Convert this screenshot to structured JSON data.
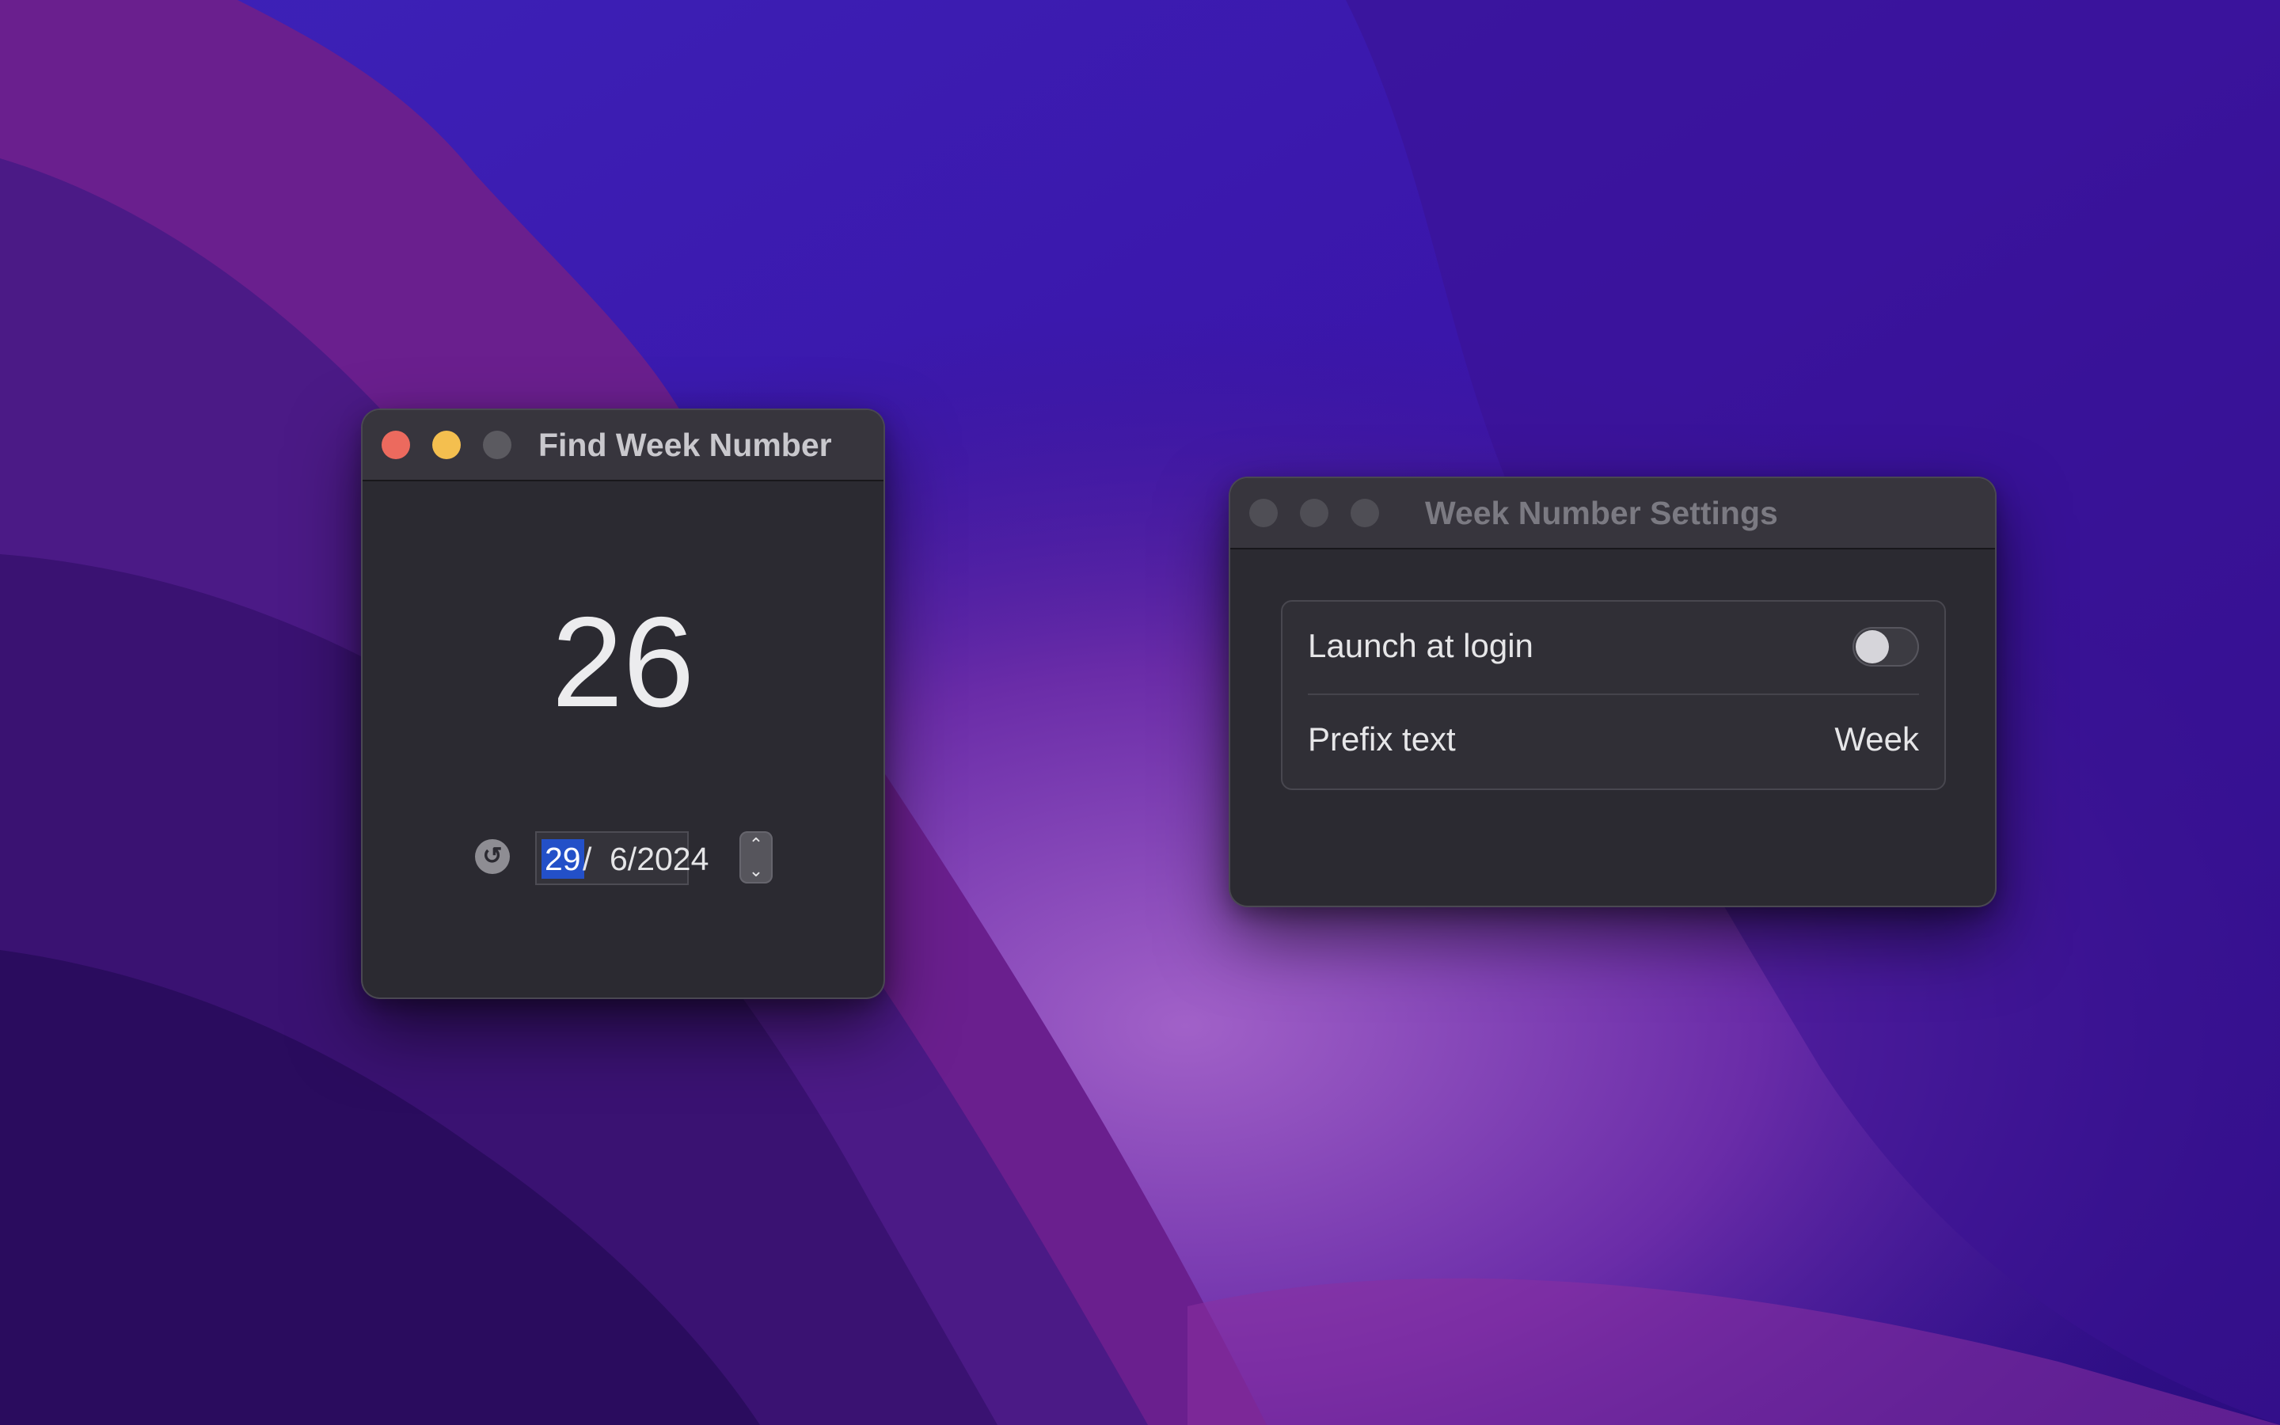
{
  "find_window": {
    "title": "Find Week Number",
    "week_number": "26",
    "date": {
      "day": "29",
      "sep": "/",
      "rest": "6/2024"
    },
    "stepper": {
      "up_icon": "chevron-up-icon",
      "down_icon": "chevron-down-icon"
    },
    "reset_icon": "reset-arrow-icon",
    "traffic_lights": {
      "close": "#ec6a5e",
      "minimize": "#f4bf4f",
      "zoom": "#5b5a60"
    }
  },
  "settings_window": {
    "title": "Week Number Settings",
    "rows": [
      {
        "label": "Launch at login",
        "toggle_on": false
      },
      {
        "label": "Prefix text",
        "value": "Week"
      }
    ],
    "traffic_lights_color": "#4f4e55"
  },
  "colors": {
    "window_bg": "#2b2a31",
    "titlebar_bg": "#37353d",
    "selection": "#2350c8"
  }
}
